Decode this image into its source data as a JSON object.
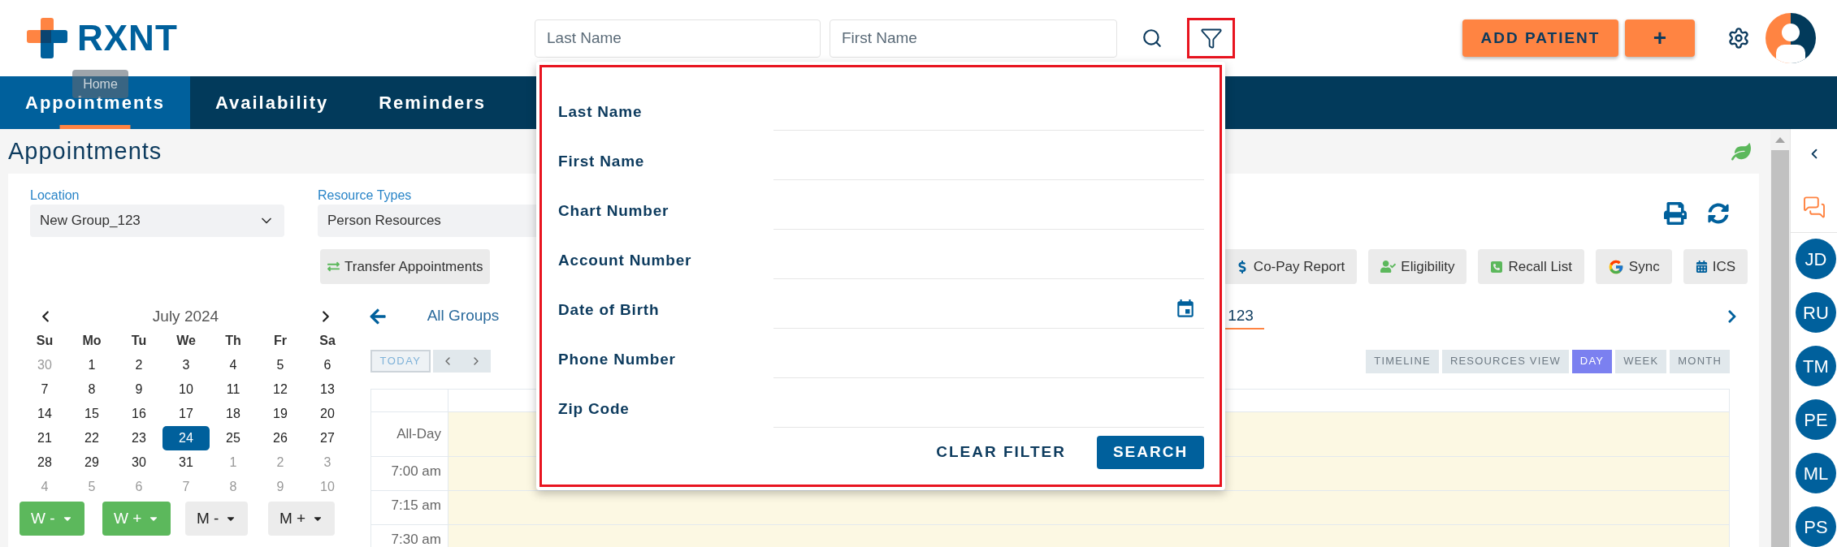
{
  "header": {
    "logo_text": "RXNT",
    "tooltip": "Home",
    "search_fields": [
      {
        "placeholder": "Last Name"
      },
      {
        "placeholder": "First Name"
      }
    ],
    "filter_highlighted": true,
    "buttons": [
      {
        "label": "ADD PATIENT"
      },
      {
        "label": "+"
      }
    ]
  },
  "nav": [
    {
      "label": "Appointments",
      "selected": true
    },
    {
      "label": "Availability",
      "selected": false
    },
    {
      "label": "Reminders",
      "selected": false
    }
  ],
  "page_title": "Appointments",
  "filters": [
    {
      "label": "Location",
      "value": "New Group_123"
    },
    {
      "label": "Resource Types",
      "value": "Person Resources"
    }
  ],
  "toolbar": {
    "left": [
      {
        "label": "Transfer Appointments"
      }
    ],
    "right": [
      {
        "label": "Co-Pay Report"
      },
      {
        "label": "Eligibility"
      },
      {
        "label": "Recall List"
      },
      {
        "label": "Sync"
      },
      {
        "label": "ICS"
      }
    ]
  },
  "mini_calendar": {
    "month": "July 2024",
    "weekdays": [
      "Su",
      "Mo",
      "Tu",
      "We",
      "Th",
      "Fr",
      "Sa"
    ],
    "days": [
      {
        "day": "30",
        "outside": true,
        "selected": false
      },
      {
        "day": "1",
        "outside": false,
        "selected": false
      },
      {
        "day": "2",
        "outside": false,
        "selected": false
      },
      {
        "day": "3",
        "outside": false,
        "selected": false
      },
      {
        "day": "4",
        "outside": false,
        "selected": false
      },
      {
        "day": "5",
        "outside": false,
        "selected": false
      },
      {
        "day": "6",
        "outside": false,
        "selected": false
      },
      {
        "day": "7",
        "outside": false,
        "selected": false
      },
      {
        "day": "8",
        "outside": false,
        "selected": false
      },
      {
        "day": "9",
        "outside": false,
        "selected": false
      },
      {
        "day": "10",
        "outside": false,
        "selected": false
      },
      {
        "day": "11",
        "outside": false,
        "selected": false
      },
      {
        "day": "12",
        "outside": false,
        "selected": false
      },
      {
        "day": "13",
        "outside": false,
        "selected": false
      },
      {
        "day": "14",
        "outside": false,
        "selected": false
      },
      {
        "day": "15",
        "outside": false,
        "selected": false
      },
      {
        "day": "16",
        "outside": false,
        "selected": false
      },
      {
        "day": "17",
        "outside": false,
        "selected": false
      },
      {
        "day": "18",
        "outside": false,
        "selected": false
      },
      {
        "day": "19",
        "outside": false,
        "selected": false
      },
      {
        "day": "20",
        "outside": false,
        "selected": false
      },
      {
        "day": "21",
        "outside": false,
        "selected": false
      },
      {
        "day": "22",
        "outside": false,
        "selected": false
      },
      {
        "day": "23",
        "outside": false,
        "selected": false
      },
      {
        "day": "24",
        "outside": false,
        "selected": true
      },
      {
        "day": "25",
        "outside": false,
        "selected": false
      },
      {
        "day": "26",
        "outside": false,
        "selected": false
      },
      {
        "day": "27",
        "outside": false,
        "selected": false
      },
      {
        "day": "28",
        "outside": false,
        "selected": false
      },
      {
        "day": "29",
        "outside": false,
        "selected": false
      },
      {
        "day": "30",
        "outside": false,
        "selected": false
      },
      {
        "day": "31",
        "outside": false,
        "selected": false
      },
      {
        "day": "1",
        "outside": true,
        "selected": false
      },
      {
        "day": "2",
        "outside": true,
        "selected": false
      },
      {
        "day": "3",
        "outside": true,
        "selected": false
      },
      {
        "day": "4",
        "outside": true,
        "selected": false
      },
      {
        "day": "5",
        "outside": true,
        "selected": false
      },
      {
        "day": "6",
        "outside": true,
        "selected": false
      },
      {
        "day": "7",
        "outside": true,
        "selected": false
      },
      {
        "day": "8",
        "outside": true,
        "selected": false
      },
      {
        "day": "9",
        "outside": true,
        "selected": false
      },
      {
        "day": "10",
        "outside": true,
        "selected": false
      }
    ]
  },
  "week_buttons": [
    {
      "label": "W -",
      "color": "#5cb85c"
    },
    {
      "label": "W +",
      "color": "#5cb85c"
    },
    {
      "label": "M -",
      "color": "#ececec"
    },
    {
      "label": "M +",
      "color": "#ececec"
    }
  ],
  "scheduler": {
    "group_tabs": [
      {
        "label": "All Groups",
        "selected": false
      },
      {
        "label": "123",
        "selected": true
      }
    ],
    "today_label": "TODAY",
    "views": [
      {
        "label": "TIMELINE",
        "selected": false
      },
      {
        "label": "RESOURCES VIEW",
        "selected": false
      },
      {
        "label": "DAY",
        "selected": true
      },
      {
        "label": "WEEK",
        "selected": false
      },
      {
        "label": "MONTH",
        "selected": false
      }
    ],
    "time_rows": [
      "All-Day",
      "7:00 am",
      "7:15 am",
      "7:30 am"
    ]
  },
  "filter_popup": {
    "highlighted": true,
    "fields": [
      {
        "label": "Last Name",
        "kind": "text"
      },
      {
        "label": "First Name",
        "kind": "text"
      },
      {
        "label": "Chart Number",
        "kind": "text"
      },
      {
        "label": "Account Number",
        "kind": "text"
      },
      {
        "label": "Date of Birth",
        "kind": "date"
      },
      {
        "label": "Phone Number",
        "kind": "text"
      },
      {
        "label": "Zip Code",
        "kind": "text"
      }
    ],
    "clear_label": "CLEAR FILTER",
    "search_label": "SEARCH"
  },
  "sidebar": {
    "avatars": [
      {
        "initials": "JD"
      },
      {
        "initials": "RU"
      },
      {
        "initials": "TM"
      },
      {
        "initials": "PE"
      },
      {
        "initials": "ML"
      },
      {
        "initials": "PS"
      }
    ]
  }
}
